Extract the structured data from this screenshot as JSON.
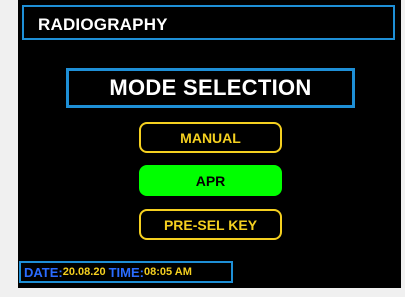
{
  "header": {
    "title": "RADIOGRAPHY"
  },
  "mode_selection": {
    "title": "MODE SELECTION",
    "options": [
      {
        "label": "MANUAL",
        "selected": false
      },
      {
        "label": "APR",
        "selected": true
      },
      {
        "label": "PRE-SEL KEY",
        "selected": false
      }
    ]
  },
  "status": {
    "date_label": "DATE:",
    "date_value": "20.08.20",
    "time_label": "TIME:",
    "time_value": "08:05 AM"
  },
  "colors": {
    "background": "#000000",
    "frame_blue": "#1e8fd6",
    "option_yellow": "#f5d020",
    "selected_green": "#00ff00",
    "label_blue": "#2a6cff"
  }
}
